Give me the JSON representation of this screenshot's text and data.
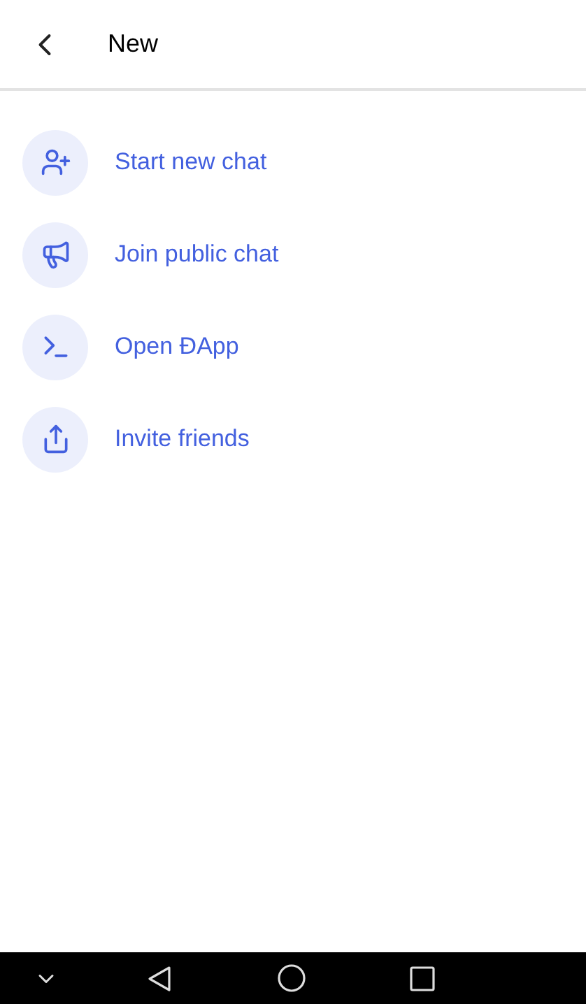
{
  "header": {
    "title": "New"
  },
  "items": [
    {
      "kind": "add-user",
      "label": "Start new chat"
    },
    {
      "kind": "megaphone",
      "label": "Join public chat"
    },
    {
      "kind": "terminal",
      "label": "Open ĐApp"
    },
    {
      "kind": "share",
      "label": "Invite friends"
    }
  ]
}
